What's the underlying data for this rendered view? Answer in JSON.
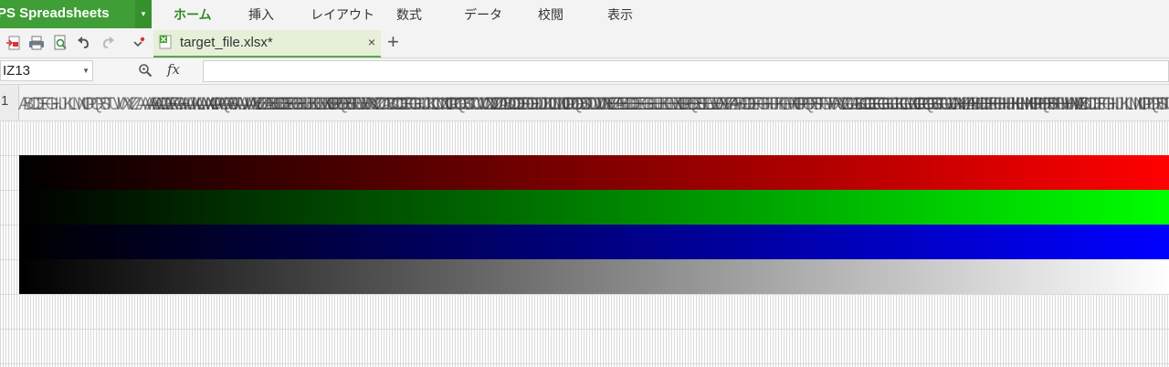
{
  "app": {
    "name": "PS Spreadsheets",
    "menu_caret": "▾"
  },
  "menu": {
    "items": [
      "ホーム",
      "挿入",
      "レイアウト",
      "数式",
      "データ",
      "校閲",
      "表示"
    ],
    "active_index": 0
  },
  "toolbar": {
    "icons": [
      "pdf-export-icon",
      "print-icon",
      "print-preview-icon",
      "undo-icon",
      "redo-icon",
      "customize-icon"
    ]
  },
  "file_tab": {
    "name": "target_file.xlsx*",
    "close": "×",
    "new_tab": "+"
  },
  "formula_bar": {
    "cell_ref": "IZ13",
    "fx_label": "fx",
    "formula": ""
  },
  "sheet": {
    "corner_label": "1",
    "column_headers_note": "A … IV (dense, illegible at this zoom)",
    "gradients": [
      {
        "name": "red-gradient",
        "from": "#000000",
        "to": "#ff0000"
      },
      {
        "name": "green-gradient",
        "from": "#000000",
        "to": "#00ff00"
      },
      {
        "name": "blue-gradient",
        "from": "#000000",
        "to": "#0000ff"
      },
      {
        "name": "gray-gradient",
        "from": "#000000",
        "to": "#ffffff"
      }
    ]
  },
  "colors": {
    "brand_green": "#3f9e36",
    "active_menu_text": "#2e8b22",
    "tab_background": "#e6efd8"
  }
}
